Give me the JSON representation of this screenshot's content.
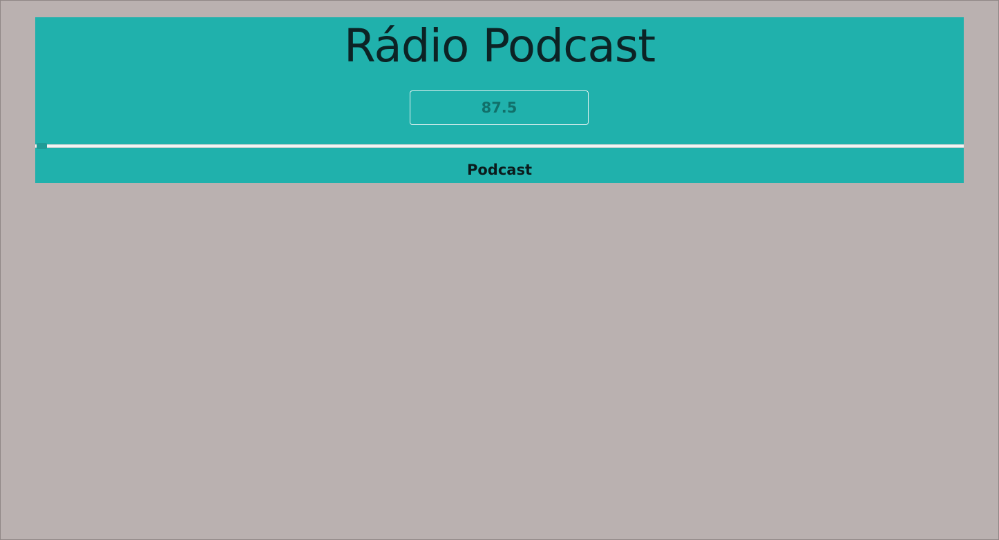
{
  "app": {
    "title": "Rádio Podcast"
  },
  "tuner": {
    "frequency": "87.5",
    "slider_position": 0
  },
  "station": {
    "label": "Podcast"
  },
  "colors": {
    "background": "#bab1b0",
    "panel": "#20b1ac",
    "frequency_text": "#11706a",
    "title_text": "#0c2325"
  }
}
